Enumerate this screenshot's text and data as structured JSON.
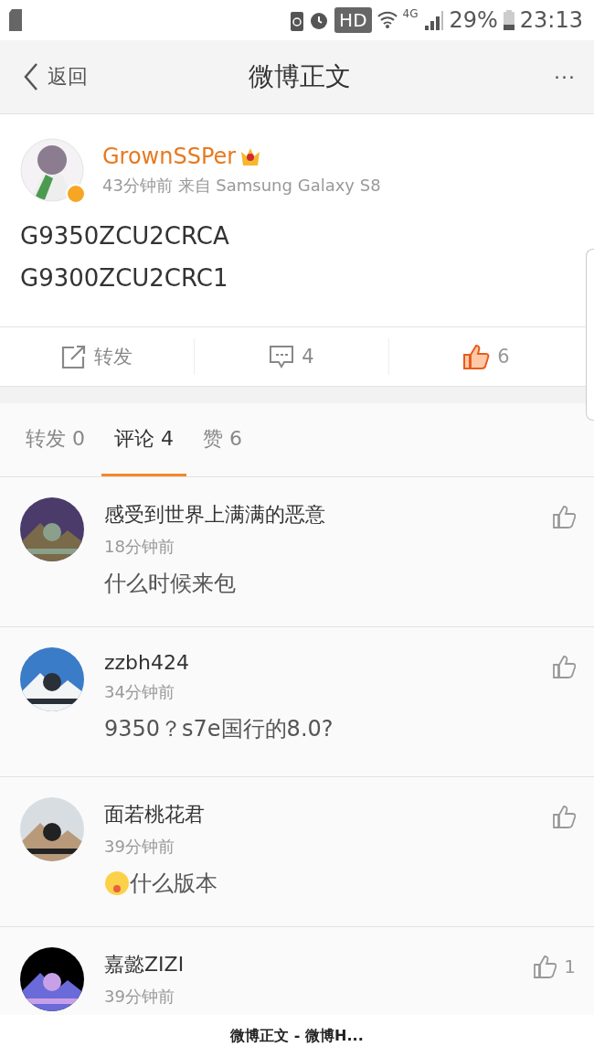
{
  "status_bar": {
    "hd": "HD",
    "network": "4G",
    "battery": "29%",
    "time": "23:13"
  },
  "nav": {
    "back": "返回",
    "title": "微博正文",
    "more": "···"
  },
  "post": {
    "author": "GrownSSPer",
    "verified": true,
    "vip": true,
    "meta": "43分钟前 来自 Samsung Galaxy S8",
    "lines": [
      "G9350ZCU2CRCA",
      "G9300ZCU2CRC1"
    ],
    "actions": [
      {
        "kind": "repost",
        "label": "转发",
        "active": false
      },
      {
        "kind": "comment",
        "label": "4",
        "active": false
      },
      {
        "kind": "like",
        "label": "6",
        "active": true
      }
    ]
  },
  "tabs": [
    {
      "label": "转发 0",
      "selected": false
    },
    {
      "label": "评论 4",
      "selected": true
    },
    {
      "label": "赞 6",
      "selected": false
    }
  ],
  "comments": [
    {
      "name": "感受到世界上满满的恶意",
      "time": "18分钟前",
      "text": "什么时候来包",
      "emoji": false
    },
    {
      "name": "zzbh424",
      "time": "34分钟前",
      "text": "9350？s7e国行的8.0?",
      "emoji": false
    },
    {
      "name": "面若桃花君",
      "time": "39分钟前",
      "text": "什么版本",
      "emoji": true
    },
    {
      "name": "嘉懿ZIZI",
      "time": "39分钟前",
      "likes": "1",
      "emoji": false
    }
  ],
  "footer": {
    "title": "微博正文 - 微博H..."
  }
}
